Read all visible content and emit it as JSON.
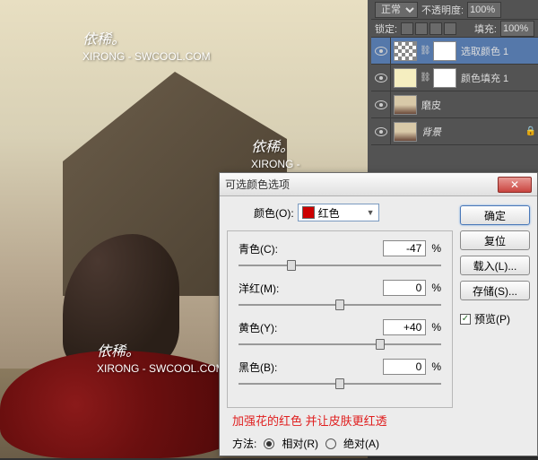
{
  "watermarks": {
    "main": "依稀。",
    "sub": "XIRONG - SWCOOL.COM"
  },
  "toolbar_side_icons": [
    "wand-icon",
    "type-icon"
  ],
  "layers_panel": {
    "blend_mode": "正常",
    "opacity_label": "不透明度:",
    "opacity_value": "100%",
    "lock_label": "锁定:",
    "fill_label": "填充:",
    "fill_value": "100%",
    "layers": [
      {
        "name": "选取颜色 1",
        "kind": "adjustment",
        "active": true
      },
      {
        "name": "颜色填充 1",
        "kind": "fill",
        "active": false
      },
      {
        "name": "磨皮",
        "kind": "pixel",
        "active": false
      },
      {
        "name": "背景",
        "kind": "background",
        "active": false,
        "locked": true
      }
    ]
  },
  "dialog": {
    "title": "可选颜色选项",
    "close_glyph": "✕",
    "color_label": "颜色(O):",
    "color_selected": "红色",
    "sliders": [
      {
        "label": "青色(C):",
        "value": "-47",
        "pos": 26
      },
      {
        "label": "洋红(M):",
        "value": "0",
        "pos": 50
      },
      {
        "label": "黄色(Y):",
        "value": "+40",
        "pos": 70
      },
      {
        "label": "黑色(B):",
        "value": "0",
        "pos": 50
      }
    ],
    "annotation": "加强花的红色 并让皮肤更红透",
    "method_label": "方法:",
    "method_relative": "相对(R)",
    "method_absolute": "绝对(A)",
    "buttons": {
      "ok": "确定",
      "cancel": "复位",
      "load": "载入(L)...",
      "save": "存储(S)..."
    },
    "preview_label": "预览(P)",
    "percent": "%"
  }
}
